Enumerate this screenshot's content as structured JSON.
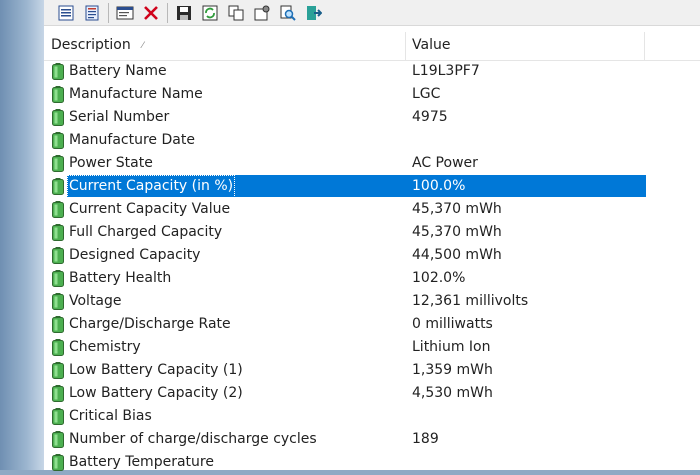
{
  "toolbar": {
    "buttons": [
      {
        "name": "html-report-icon"
      },
      {
        "name": "properties-icon"
      },
      {
        "name": "window-icon"
      },
      {
        "name": "close-icon"
      },
      {
        "name": "save-icon"
      },
      {
        "name": "refresh-icon"
      },
      {
        "name": "copy-icon"
      },
      {
        "name": "options-icon"
      },
      {
        "name": "find-icon"
      },
      {
        "name": "exit-icon"
      }
    ]
  },
  "columns": {
    "description": "Description",
    "value": "Value"
  },
  "rows": [
    {
      "desc": "Battery Name",
      "value": "L19L3PF7"
    },
    {
      "desc": "Manufacture Name",
      "value": "LGC"
    },
    {
      "desc": "Serial Number",
      "value": "4975"
    },
    {
      "desc": "Manufacture Date",
      "value": ""
    },
    {
      "desc": "Power State",
      "value": "AC Power"
    },
    {
      "desc": "Current Capacity (in %)",
      "value": "100.0%"
    },
    {
      "desc": "Current Capacity Value",
      "value": "45,370 mWh"
    },
    {
      "desc": "Full Charged Capacity",
      "value": "45,370 mWh"
    },
    {
      "desc": "Designed Capacity",
      "value": "44,500 mWh"
    },
    {
      "desc": "Battery Health",
      "value": "102.0%"
    },
    {
      "desc": "Voltage",
      "value": "12,361 millivolts"
    },
    {
      "desc": "Charge/Discharge Rate",
      "value": "0 milliwatts"
    },
    {
      "desc": "Chemistry",
      "value": "Lithium Ion"
    },
    {
      "desc": "Low Battery Capacity (1)",
      "value": "1,359 mWh"
    },
    {
      "desc": "Low Battery Capacity (2)",
      "value": "4,530 mWh"
    },
    {
      "desc": "Critical Bias",
      "value": ""
    },
    {
      "desc": "Number of charge/discharge cycles",
      "value": "189"
    },
    {
      "desc": "Battery Temperature",
      "value": ""
    }
  ],
  "selected_row": 5,
  "colors": {
    "selection": "#0078d7",
    "battery_icon": "#4caf50"
  }
}
